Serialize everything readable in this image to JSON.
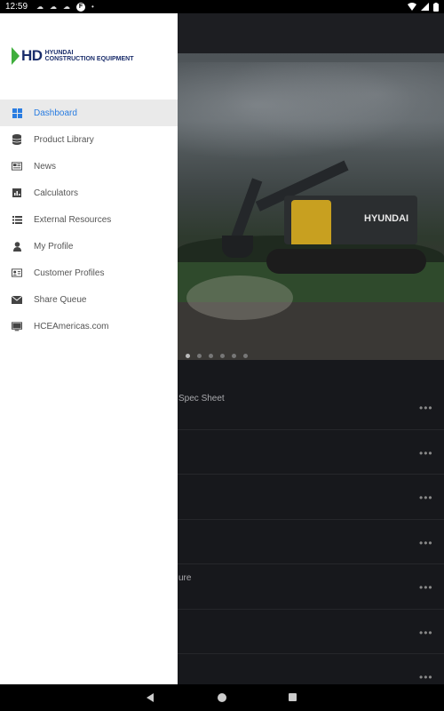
{
  "status_bar": {
    "time": "12:59",
    "notification_icons": [
      "cloud-icon",
      "cloud-icon",
      "cloud-icon",
      "flipboard-icon",
      "dot-icon"
    ],
    "right_icons": [
      "wifi-icon",
      "signal-icon",
      "battery-icon"
    ]
  },
  "drawer": {
    "logo": {
      "mark": "HD",
      "line1": "HYUNDAI",
      "line2": "CONSTRUCTION EQUIPMENT"
    },
    "items": [
      {
        "label": "Dashboard",
        "icon": "dashboard-icon",
        "active": true
      },
      {
        "label": "Product Library",
        "icon": "database-icon",
        "active": false
      },
      {
        "label": "News",
        "icon": "newspaper-icon",
        "active": false
      },
      {
        "label": "Calculators",
        "icon": "bar-chart-icon",
        "active": false
      },
      {
        "label": "External Resources",
        "icon": "list-icon",
        "active": false
      },
      {
        "label": "My Profile",
        "icon": "user-icon",
        "active": false
      },
      {
        "label": "Customer Profiles",
        "icon": "id-card-icon",
        "active": false
      },
      {
        "label": "Share Queue",
        "icon": "envelope-icon",
        "active": false
      },
      {
        "label": "HCEAmericas.com",
        "icon": "monitor-icon",
        "active": false
      }
    ]
  },
  "background": {
    "hero_brand": "HYUNDAI",
    "carousel": {
      "count": 6,
      "active_index": 0
    },
    "list_rows": [
      {
        "text": "Spec Sheet",
        "more": "•••"
      },
      {
        "text": "",
        "more": "•••"
      },
      {
        "text": "",
        "more": "•••"
      },
      {
        "text": "",
        "more": "•••"
      },
      {
        "text": "ure",
        "more": "•••"
      },
      {
        "text": "",
        "more": "•••"
      },
      {
        "text": "",
        "more": "•••"
      }
    ]
  },
  "colors": {
    "accent": "#2a7de1",
    "brand_navy": "#1a2d6b",
    "brand_green": "#3fae3c",
    "active_row_bg": "#eaeaea"
  }
}
